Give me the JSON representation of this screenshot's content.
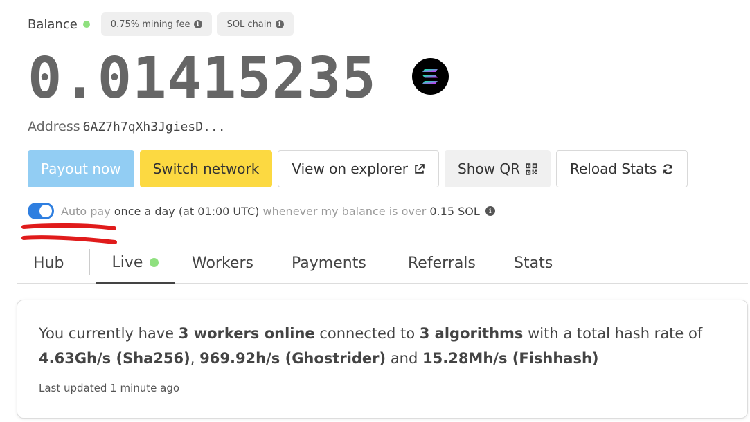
{
  "balance": {
    "label": "Balance",
    "status_color": "#8fe07f",
    "fee_pill": "0.75% mining fee",
    "chain_pill": "SOL chain",
    "amount": "0.01415235",
    "coin_icon": "solana-logo-icon"
  },
  "address": {
    "label": "Address",
    "value": "6AZ7h7qXh3JgiesD..."
  },
  "actions": {
    "payout": "Payout now",
    "switch": "Switch network",
    "explorer": "View on explorer",
    "qr": "Show QR",
    "reload": "Reload Stats"
  },
  "autopay": {
    "enabled": true,
    "prefix": "Auto pay",
    "schedule": "once a day (at 01:00 UTC)",
    "middle": "whenever my balance is over",
    "threshold": "0.15 SOL"
  },
  "tabs": {
    "hub": "Hub",
    "live": "Live",
    "workers": "Workers",
    "payments": "Payments",
    "referrals": "Referrals",
    "stats": "Stats"
  },
  "live": {
    "t1": "You currently have ",
    "workers": "3 workers online",
    "t2": " connected to ",
    "algorithms": "3 algorithms",
    "t3": " with a total hash rate of ",
    "rate1": "4.63Gh/s (Sha256)",
    "t4": ", ",
    "rate2": "969.92h/s (Ghostrider)",
    "t5": " and ",
    "rate3": "15.28Mh/s (Fishhash)",
    "updated": "Last updated 1 minute ago"
  },
  "colors": {
    "payout_button": "#92cdf3",
    "switch_button": "#fcd941",
    "toggle_on": "#2f7fe0",
    "annotation": "#e01b1b"
  }
}
